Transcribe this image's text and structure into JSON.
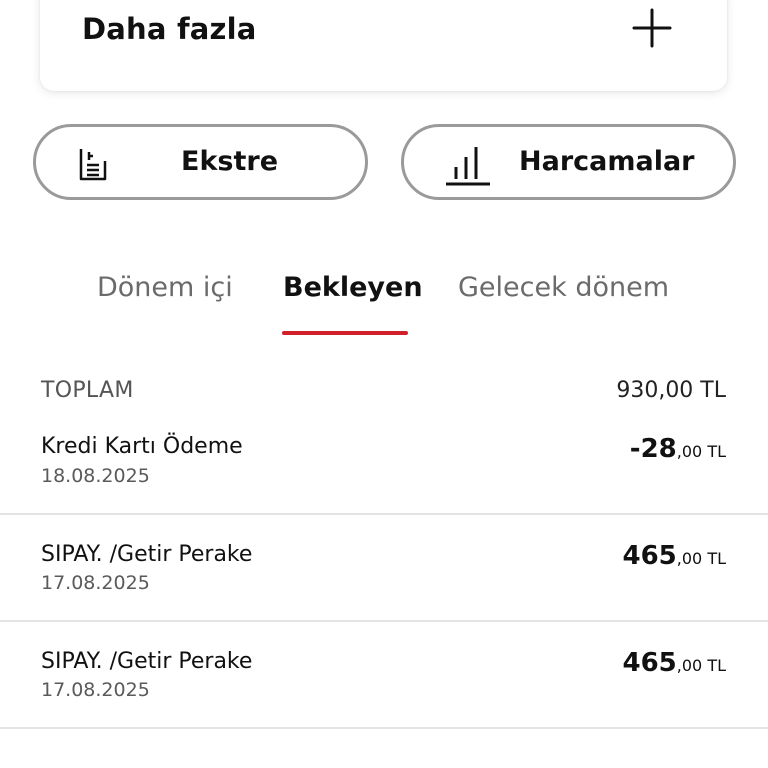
{
  "more_card": {
    "label": "Daha fazla",
    "expand_icon": "plus-icon"
  },
  "actions": {
    "statement": {
      "label": "Ekstre",
      "icon": "document-icon"
    },
    "spending": {
      "label": "Harcamalar",
      "icon": "bar-chart-icon"
    }
  },
  "tabs": [
    {
      "label": "Dönem içi",
      "active": false
    },
    {
      "label": "Bekleyen",
      "active": true
    },
    {
      "label": "Gelecek dönem",
      "active": false
    }
  ],
  "summary": {
    "total_label": "TOPLAM",
    "total_value": "930,00 TL"
  },
  "transactions": [
    {
      "title": "Kredi Kartı Ödeme",
      "date": "18.08.2025",
      "amount_int": "-28",
      "amount_dec": ",00 TL"
    },
    {
      "title": "SIPAY. /Getir Perake",
      "date": "17.08.2025",
      "amount_int": "465",
      "amount_dec": ",00 TL"
    },
    {
      "title": "SIPAY. /Getir Perake",
      "date": "17.08.2025",
      "amount_int": "465",
      "amount_dec": ",00 TL"
    }
  ],
  "colors": {
    "accent": "#d0202a",
    "pill_border": "#9a9a9a",
    "divider": "#e4e4e4"
  }
}
